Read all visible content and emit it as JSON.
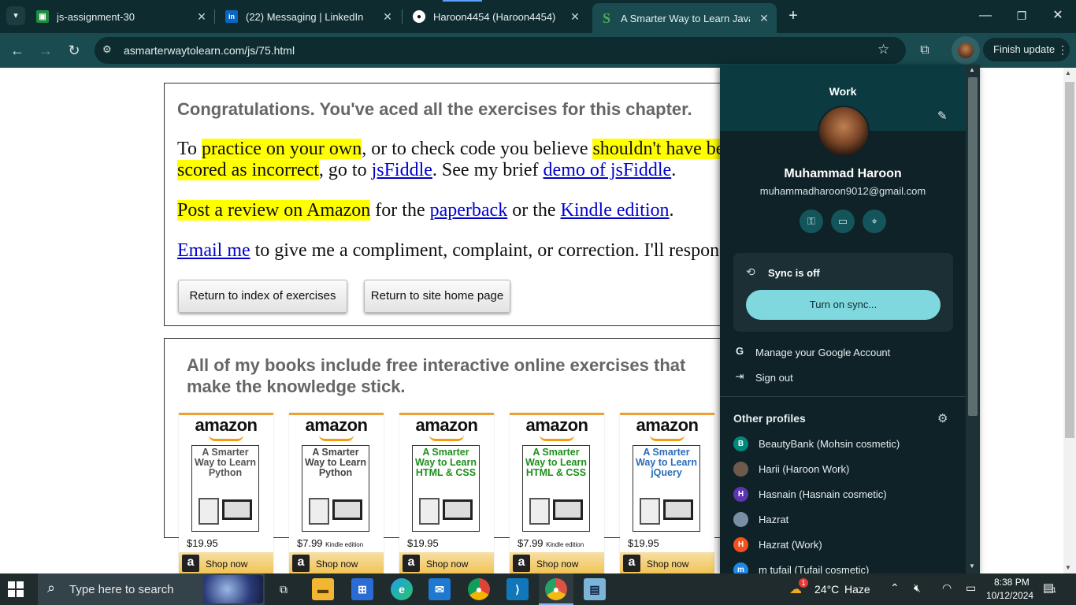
{
  "browser": {
    "tabs": [
      {
        "title": "js-assignment-30",
        "icon": "google-classroom-icon",
        "color": "#1e8e3e"
      },
      {
        "title": "(22) Messaging | LinkedIn",
        "icon": "linkedin-icon",
        "color": "#0a66c2"
      },
      {
        "title": "Haroon4454 (Haroon4454)",
        "icon": "github-icon",
        "color": "#ffffff"
      },
      {
        "title": "A Smarter Way to Learn JavaScript",
        "icon": "smarter-way-icon",
        "color": "#4caf50"
      }
    ],
    "new_tab_symbol": "+",
    "url": "asmarterwaytolearn.com/js/75.html",
    "finish_update_label": "Finish update"
  },
  "page": {
    "congrats_heading": "Congratulations. You've aced all the exercises for this chapter.",
    "p1": {
      "a": "To ",
      "hl1": "practice on your own",
      "b": ", or to check code you believe ",
      "hl2": "shouldn't have been",
      "hl3": "scored as incorrect",
      "c": ", go to ",
      "link1": "jsFiddle",
      "d": ". See my brief ",
      "link2": "demo of jsFiddle",
      "e": "."
    },
    "p2": {
      "hl": "Post a review on Amazon",
      "a": " for the ",
      "link1": "paperback",
      "b": " or the ",
      "link2": "Kindle edition",
      "c": "."
    },
    "p3": {
      "link": "Email me",
      "a": " to give me a compliment, complaint, or correction. I'll respond."
    },
    "btn_index": "Return to index of exercises",
    "btn_home": "Return to site home page",
    "books_heading": "All of my books include free interactive online exercises that make the knowledge stick.",
    "books": [
      {
        "brand": "amazon",
        "title": "A Smarter Way to Learn Python",
        "price": "$19.95",
        "note": "",
        "shop": "Shop now",
        "title_color": "#555555"
      },
      {
        "brand": "amazon",
        "title": "A Smarter Way to Learn Python",
        "price": "$7.99",
        "note": "Kindle edition",
        "shop": "Shop now",
        "title_color": "#444444"
      },
      {
        "brand": "amazon",
        "title": "A Smarter Way to Learn HTML & CSS",
        "price": "$19.95",
        "note": "",
        "shop": "Shop now",
        "title_color": "#1e8e1e"
      },
      {
        "brand": "amazon",
        "title": "A Smarter Way to Learn HTML & CSS",
        "price": "$7.99",
        "note": "Kindle edition",
        "shop": "Shop now",
        "title_color": "#1e8e1e"
      },
      {
        "brand": "amazon",
        "title": "A Smarter Way to Learn jQuery",
        "price": "$19.95",
        "note": "",
        "shop": "Shop now",
        "title_color": "#2a6db8"
      }
    ]
  },
  "profile_panel": {
    "title": "Work",
    "name": "Muhammad Haroon",
    "email": "muhammadharoon9012@gmail.com",
    "quick_icons": [
      "password-key-icon",
      "payment-card-icon",
      "address-pin-icon"
    ],
    "sync_status": "Sync is off",
    "sync_button": "Turn on sync...",
    "manage_account": "Manage your Google Account",
    "sign_out": "Sign out",
    "other_profiles_label": "Other profiles",
    "other_profiles": [
      {
        "initial": "B",
        "name": "BeautyBank (Mohsin cosmetic)",
        "color": "#00897b"
      },
      {
        "initial": "",
        "name": "Harii (Haroon Work)",
        "color": "#6d5a4c"
      },
      {
        "initial": "H",
        "name": "Hasnain (Hasnain cosmetic)",
        "color": "#5e35b1"
      },
      {
        "initial": "",
        "name": "Hazrat",
        "color": "#7a8fa6"
      },
      {
        "initial": "H",
        "name": "Hazrat (Work)",
        "color": "#f4511e"
      },
      {
        "initial": "m",
        "name": "m tufail (Tufail cosmetic)",
        "color": "#1e88e5"
      }
    ]
  },
  "taskbar": {
    "search_placeholder": "Type here to search",
    "weather_temp": "24°C",
    "weather_text": "Haze",
    "weather_badge": "1",
    "time": "8:38 PM",
    "date": "10/12/2024",
    "notification_count": "1"
  }
}
